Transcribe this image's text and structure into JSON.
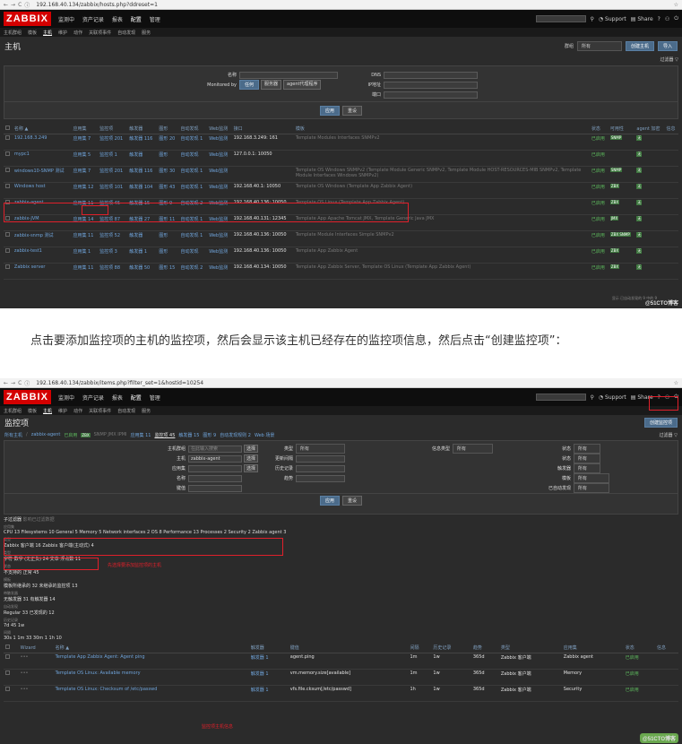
{
  "shot1": {
    "url": "192.168.40.134/zabbix/hosts.php?ddreset=1",
    "logo": "ZABBIX",
    "menu": [
      "监测中",
      "资产记录",
      "报表",
      "配置",
      "管理"
    ],
    "submenu": [
      "主机群组",
      "模板",
      "主机",
      "维护",
      "动作",
      "关联项事件",
      "自动发现",
      "服务"
    ],
    "page_title": "主机",
    "group_label": "群组",
    "group_value": "所有",
    "create_host": "创建主机",
    "import": "导入",
    "filter_tab": "过滤器",
    "filter": {
      "name_label": "名称",
      "monitored_by_label": "Monitored by",
      "monitored_options": [
        "任何",
        "服务器",
        "agent代理程序"
      ],
      "dns_label": "DNS",
      "ip_label": "IP地址",
      "port_label": "端口",
      "apply": "应用",
      "reset": "重设"
    },
    "columns": [
      "名称 ▲",
      "应用集",
      "监控项",
      "触发器",
      "图形",
      "自动发现",
      "Web监测",
      "接口",
      "模板",
      "状态",
      "可用性",
      "agent 加密",
      "信息"
    ],
    "rows": [
      {
        "name": "192.168.3.249",
        "apps": "应用集 7",
        "items": "监控项 201",
        "triggers": "触发器 116",
        "graphs": "图形 20",
        "discovery": "自动发现 1",
        "web": "Web监测",
        "iface": "192.168.3.249: 161",
        "templates": "Template Modules Interfaces SNMPv2",
        "status": "已启用",
        "avail": "SNMP"
      },
      {
        "name": "mypc1",
        "apps": "应用集 5",
        "items": "监控项 1",
        "triggers": "触发器",
        "graphs": "图形",
        "discovery": "自动发现",
        "web": "Web监测",
        "iface": "127.0.0.1: 10050",
        "templates": "",
        "status": "已启用",
        "avail": ""
      },
      {
        "name": "windows10-SNMP 测试",
        "apps": "应用集 7",
        "items": "监控项 201",
        "triggers": "触发器 116",
        "graphs": "图形 30",
        "discovery": "自动发现 1",
        "web": "Web监测",
        "iface": "",
        "templates": "Template OS Windows SNMPv2 (Template Module Generic SNMPv2, Template Module HOST-RESOURCES-MIB SNMPv2, Template Module Interfaces Windows SNMPv2)",
        "status": "已启用",
        "avail": "SNMP"
      },
      {
        "name": "Windows host",
        "apps": "应用集 12",
        "items": "监控项 101",
        "triggers": "触发器 104",
        "graphs": "图形 43",
        "discovery": "自动发现 1",
        "web": "Web监测",
        "iface": "192.168.40.1: 10050",
        "templates": "Template OS Windows (Template App Zabbix Agent)",
        "status": "已启用",
        "avail": "ZBX"
      },
      {
        "name": "zabbix-agent",
        "apps": "应用集 11",
        "items": "监控项 45",
        "triggers": "触发器 15",
        "graphs": "图形 9",
        "discovery": "自动发现 2",
        "web": "Web监测",
        "iface": "192.168.40.136: 10050",
        "templates": "Template OS Linux (Template App Zabbix Agent)",
        "status": "已启用",
        "avail": "ZBX"
      },
      {
        "name": "zabbix-JVM",
        "apps": "应用集 14",
        "items": "监控项 87",
        "triggers": "触发器 27",
        "graphs": "图形 11",
        "discovery": "自动发现 1",
        "web": "Web监测",
        "iface": "192.168.40.131: 12345",
        "templates": "Template App Apache Tomcat JMX, Template Generic Java JMX",
        "status": "已启用",
        "avail": "JMX"
      },
      {
        "name": "zabbix-snmp 测试",
        "apps": "应用集 11",
        "items": "监控项 52",
        "triggers": "触发器",
        "graphs": "图形",
        "discovery": "自动发现 1",
        "web": "Web监测",
        "iface": "192.168.40.136: 10050",
        "templates": "Template Module Interfaces Simple SNMPv2",
        "status": "已启用",
        "avail": "ZBX SNMP"
      },
      {
        "name": "zabbix-test1",
        "apps": "应用集 1",
        "items": "监控项 3",
        "triggers": "触发器 1",
        "graphs": "图形",
        "discovery": "自动发现",
        "web": "Web监测",
        "iface": "192.168.40.136: 10050",
        "templates": "Template App Zabbix Agent",
        "status": "已启用",
        "avail": "ZBX"
      },
      {
        "name": "Zabbix server",
        "apps": "应用集 11",
        "items": "监控项 88",
        "triggers": "触发器 50",
        "graphs": "图形 15",
        "discovery": "自动发现 2",
        "web": "Web监测",
        "iface": "192.168.40.134: 10050",
        "templates": "Template App Zabbix Server, Template OS Linux (Template App Zabbix Agent)",
        "status": "已启用",
        "avail": "ZBX"
      }
    ],
    "footer": "显示 已自动发现的 9 中的 9"
  },
  "caption": "点击要添加监控项的主机的监控项，然后会显示该主机已经存在的监控项信息，然后点击“创建监控项”：",
  "shot2": {
    "url": "192.168.40.134/zabbix/items.php?filter_set=1&hostid=10254",
    "page_title": "监控项",
    "create_item": "创建监控项",
    "filter_tab": "过滤器",
    "breadcrumb": [
      "所有主机",
      "zabbix-agent",
      "已启用",
      "ZBX",
      "SNMP JMX IPMI",
      "应用集 11",
      "监控项 45",
      "触发器 15",
      "图形 9",
      "自动发现规则 2",
      "Web 场景"
    ],
    "filter": {
      "hostgroup_label": "主机群组",
      "hostgroup_placeholder": "在此输入搜索",
      "host_label": "主机",
      "host_value": "zabbix-agent",
      "app_label": "应用集",
      "name_label": "名称",
      "key_label": "键值",
      "select": "选择",
      "type_label": "类型",
      "type_value": "所有",
      "interval_label": "更新间隔",
      "history_label": "历史记录",
      "trends_label": "趋势",
      "infotype_label": "信息类型",
      "infotype_value": "所有",
      "state_label": "状态",
      "state_value": "所有",
      "status_label": "状态",
      "status_value": "所有",
      "triggers_label": "触发器",
      "triggers_value": "所有",
      "template_label": "模板",
      "template_value": "所有",
      "discovered_label": "已自动发现",
      "discovered_value": "所有",
      "apply": "应用",
      "reset": "重设"
    },
    "subfilter_title": "子过滤器",
    "subfilter_note": "影响已过滤数据",
    "groups": [
      {
        "label": "应用集",
        "vals": "CPU 13  Filesystems 10  General 5  Memory 5  Network interfaces 2  OS 8  Performance 13  Processes 2  Security 2  Zabbix agent 3"
      },
      {
        "label": "类型",
        "vals": "Zabbix 客户端 16  Zabbix 客户端(主动式) 4"
      },
      {
        "label": "类型",
        "vals": "字符  数字 (无正负) 24  文本  浮点数 11"
      },
      {
        "label": "状态",
        "vals": "不支持的  正常 45"
      },
      {
        "label": "模板",
        "vals": "模板所继承的 32  未继承的监控项 13"
      },
      {
        "label": "带触发器",
        "vals": "无触发器 31  有触发器 14"
      },
      {
        "label": "自动发现",
        "vals": "Regular 33  已发现的 12"
      },
      {
        "label": "历史记录",
        "vals": "7d 45  1w"
      },
      {
        "label": "间隔",
        "vals": "30s 1  1m 33  30m 1  1h 10"
      }
    ],
    "annot1": "先选择要添加监控项的主机",
    "annot2": "监控项主机信息",
    "columns": [
      "Wizard",
      "名称 ▲",
      "触发器",
      "键值",
      "间隔",
      "历史记录",
      "趋势",
      "类型",
      "应用集",
      "状态",
      "信息"
    ],
    "rows": [
      {
        "wizard": "•••",
        "name": "Template App Zabbix Agent: Agent ping",
        "triggers": "触发器 1",
        "key": "agent.ping",
        "interval": "1m",
        "history": "1w",
        "trends": "365d",
        "type": "Zabbix 客户端",
        "app": "Zabbix agent",
        "status": "已启用"
      },
      {
        "wizard": "•••",
        "name": "Template OS Linux: Available memory",
        "triggers": "触发器 1",
        "key": "vm.memory.size[available]",
        "interval": "1m",
        "history": "1w",
        "trends": "365d",
        "type": "Zabbix 客户端",
        "app": "Memory",
        "status": "已启用"
      },
      {
        "wizard": "•••",
        "name": "Template OS Linux: Checksum of /etc/passwd",
        "triggers": "触发器 1",
        "key": "vfs.file.cksum[/etc/passwd]",
        "interval": "1h",
        "history": "1w",
        "trends": "365d",
        "type": "Zabbix 客户端",
        "app": "Security",
        "status": "已启用"
      }
    ]
  },
  "watermark": "@51CTO博客"
}
